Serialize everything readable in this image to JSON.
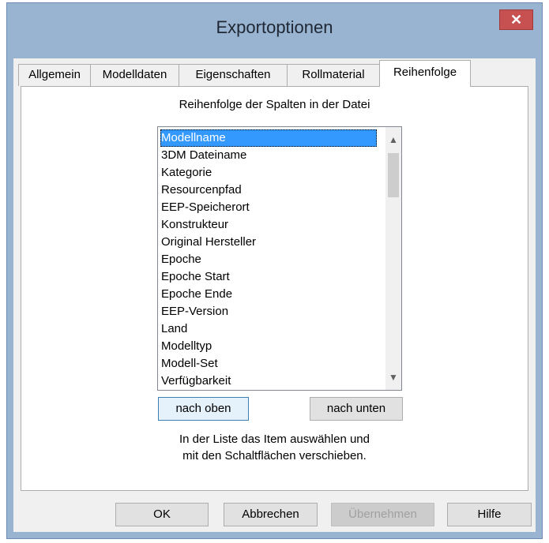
{
  "window": {
    "title": "Exportoptionen"
  },
  "tabs": [
    {
      "label": "Allgemein"
    },
    {
      "label": "Modelldaten"
    },
    {
      "label": "Eigenschaften"
    },
    {
      "label": "Rollmaterial"
    },
    {
      "label": "Reihenfolge",
      "active": true
    }
  ],
  "panel": {
    "heading": "Reihenfolge der Spalten in der Datei",
    "list_items": [
      "Modellname",
      "3DM Dateiname",
      "Kategorie",
      "Resourcenpfad",
      "EEP-Speicherort",
      "Konstrukteur",
      "Original Hersteller",
      "Epoche",
      "Epoche Start",
      "Epoche Ende",
      "EEP-Version",
      "Land",
      "Modelltyp",
      "Modell-Set",
      "Verfügbarkeit"
    ],
    "selected_item": "Modellname",
    "move_up_label": "nach oben",
    "move_down_label": "nach unten",
    "hint_line1": "In der Liste das Item auswählen und",
    "hint_line2": "mit den Schaltflächen verschieben."
  },
  "footer": {
    "ok_label": "OK",
    "cancel_label": "Abbrechen",
    "apply_label": "Übernehmen",
    "help_label": "Hilfe"
  },
  "colors": {
    "titlebar": "#99b4d1",
    "close": "#c75050",
    "selection": "#3399ff"
  },
  "icons": {
    "close": "close-icon",
    "scroll_up": "chevron-up-icon",
    "scroll_down": "chevron-down-icon"
  }
}
